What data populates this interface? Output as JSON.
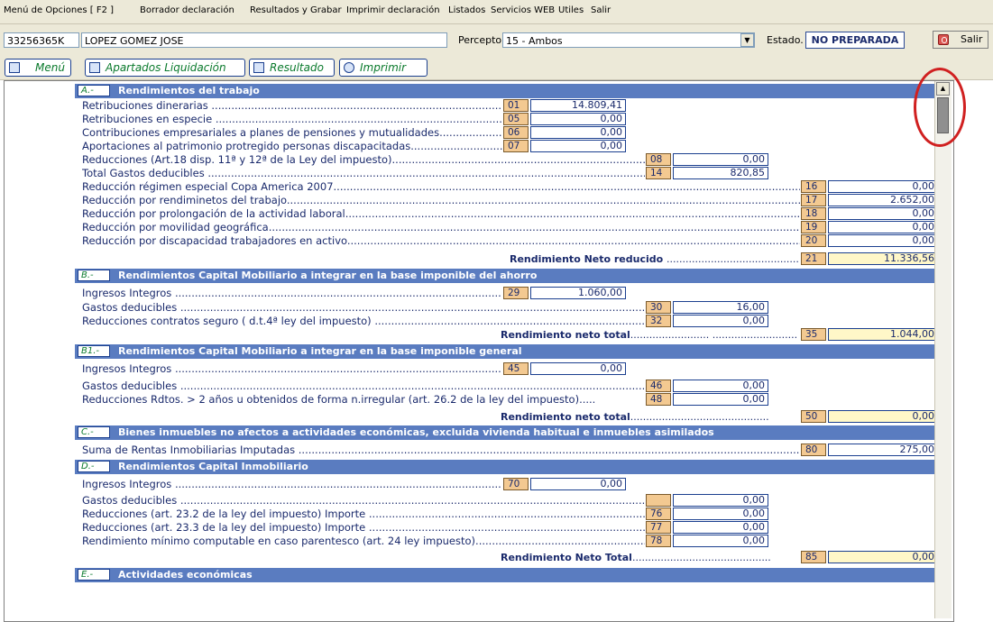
{
  "menu": [
    {
      "label": "Menú de Opciones [ F2 ]"
    },
    {
      "label": "Borrador  declaración"
    },
    {
      "label": "Resultados y Grabar"
    },
    {
      "label": "Imprimir declaración"
    },
    {
      "label": "Listados"
    },
    {
      "label": "Servicios WEB"
    },
    {
      "label": "Utiles"
    },
    {
      "label": "Salir"
    }
  ],
  "header": {
    "nif": "33256365K",
    "name": "LOPEZ GOMEZ JOSE",
    "perceptor_label": "Perceptor",
    "perceptor_value": "15 - Ambos",
    "estado_label": "Estado.",
    "estado_value": "NO PREPARADA",
    "salir_label": "Salir"
  },
  "toolbar": {
    "menu": "Menú",
    "apartados": "Apartados Liquidación",
    "resultado": "Resultado",
    "imprimir": "Imprimir"
  },
  "sections": [
    {
      "tag": "A.-",
      "title": "Rendimientos del trabajo"
    },
    {
      "tag": "B.-",
      "title": "Rendimientos Capital Mobiliario a integrar en la base imponible del ahorro"
    },
    {
      "tag": "B1.-",
      "title": "Rendimientos Capital Mobiliario a integrar en la base imponible general"
    },
    {
      "tag": "C.-",
      "title": "Bienes inmuebles no afectos a actividades económicas, excluida vivienda habitual e inmuebles asimilados"
    },
    {
      "tag": "D.-",
      "title": "Rendimientos Capital Inmobiliario"
    },
    {
      "tag": "E.-",
      "title": "Actividades económicas"
    }
  ],
  "rows": [
    {
      "label": "Retribuciones dinerarias ",
      "code": "01",
      "value": "14.809,41"
    },
    {
      "label": "Retribuciones en especie ",
      "code": "05",
      "value": "0,00"
    },
    {
      "label": "Contribuciones empresariales a planes de pensiones y mutualidades",
      "code": "06",
      "value": "0,00"
    },
    {
      "label": "Aportaciones al patrimonio protregido personas discapacitadas",
      "code": "07",
      "value": "0,00"
    },
    {
      "label": "Reducciones (Art.18 disp. 11ª y 12ª de la Ley del impuesto)",
      "code": "08",
      "value": "0,00"
    },
    {
      "label": "Total Gastos deducibles ",
      "code": "14",
      "value": "820,85"
    },
    {
      "label": "Reducción régimen especial Copa America 2007",
      "code": "16",
      "value": "0,00"
    },
    {
      "label": "Reducción por rendiminetos del trabajo",
      "code": "17",
      "value": "2.652,00"
    },
    {
      "label": "Reducción por prolongación de la actividad laboral",
      "code": "18",
      "value": "0,00"
    },
    {
      "label": "Reducción por movilidad geográfica",
      "code": "19",
      "value": "0,00"
    },
    {
      "label": "Reducción por discapacidad trabajadores en activo",
      "code": "20",
      "value": "0,00"
    },
    {
      "label": "Ingresos Integros ",
      "code": "29",
      "value": "1.060,00"
    },
    {
      "label": "Gastos deducibles ",
      "code": "30",
      "value": "16,00"
    },
    {
      "label": "Reducciones contratos seguro ( d.t.4ª ley del impuesto) ",
      "code": "32",
      "value": "0,00"
    },
    {
      "label": "Ingresos Integros ",
      "code": "45",
      "value": "0,00"
    },
    {
      "label": "Gastos deducibles ",
      "code": "46",
      "value": "0,00"
    },
    {
      "label": "Reducciones Rdtos. > 2 años u obtenidos de forma n.irregular (art. 26.2 de la ley del impuesto)",
      "code": "48",
      "value": "0,00"
    },
    {
      "label": "Suma de Rentas Inmobiliarias Imputadas ",
      "code": "80",
      "value": "275,00"
    },
    {
      "label": "Ingresos Integros ",
      "code": "70",
      "value": "0,00"
    },
    {
      "label": "Gastos deducibles ",
      "code": "",
      "value": "0,00"
    },
    {
      "label": "Reducciones (art. 23.2 de la ley del impuesto) Importe ",
      "code": "76",
      "value": "0,00"
    },
    {
      "label": "Reducciones (art. 23.3 de la ley del impuesto) Importe ",
      "code": "77",
      "value": "0,00"
    },
    {
      "label": "Rendimiento mínimo computable en caso parentesco (art. 24 ley impuesto)",
      "code": "78",
      "value": "0,00"
    }
  ],
  "totals": [
    {
      "label": "Rendimiento Neto reducido ",
      "code": "21",
      "value": "11.336,56"
    },
    {
      "label": "Rendimiento neto  total",
      "code": "35",
      "value": "1.044,00"
    },
    {
      "label": "Rendimiento neto total",
      "code": "50",
      "value": "0,00"
    },
    {
      "label": "Rendimiento Neto Total",
      "code": "85",
      "value": "0,00"
    }
  ],
  "colors": {
    "section": "#5a7cc0",
    "code_bg": "#f3c991",
    "total_bg": "#fff7c8",
    "highlight_circle": "#d02020"
  }
}
